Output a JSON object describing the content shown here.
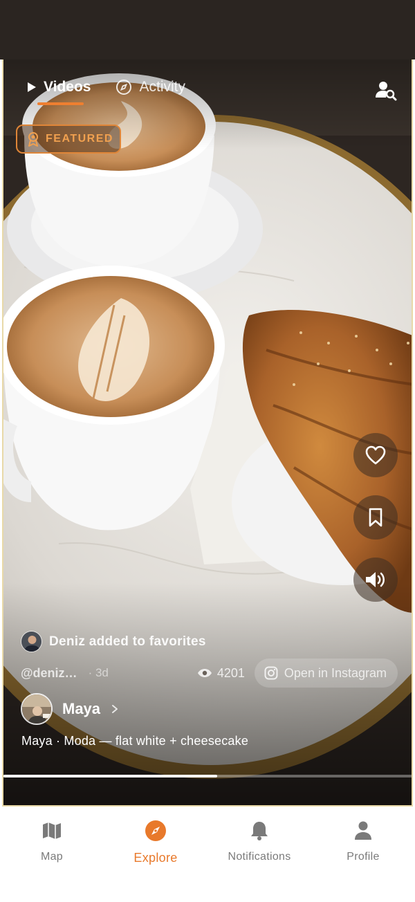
{
  "tabs": [
    {
      "label": "Videos",
      "icon": "play-icon",
      "active": true
    },
    {
      "label": "Activity",
      "icon": "compass-icon",
      "active": false
    }
  ],
  "featured_badge": {
    "label": "FEATURED",
    "icon": "award-icon"
  },
  "activity": {
    "text": "Deniz added to favorites"
  },
  "post": {
    "handle": "@deniz…",
    "age": "· 3d",
    "views": "4201",
    "instagram_button": "Open in Instagram",
    "author": "Maya",
    "caption": "Maya · Moda — flat white + cheesecake",
    "progress": 0.52
  },
  "actions": [
    {
      "name": "like",
      "icon": "heart-icon"
    },
    {
      "name": "save",
      "icon": "bookmark-icon"
    },
    {
      "name": "sound",
      "icon": "speaker-icon"
    }
  ],
  "bottom_nav": [
    {
      "label": "Map",
      "icon": "map-icon",
      "active": false
    },
    {
      "label": "Explore",
      "icon": "compass-icon",
      "active": true
    },
    {
      "label": "Notifications",
      "icon": "bell-icon",
      "active": false
    },
    {
      "label": "Profile",
      "icon": "person-icon",
      "active": false
    }
  ],
  "colors": {
    "accent": "#e8792b",
    "status_bar": "#2b2521",
    "nav_inactive": "#7a7a7a"
  }
}
